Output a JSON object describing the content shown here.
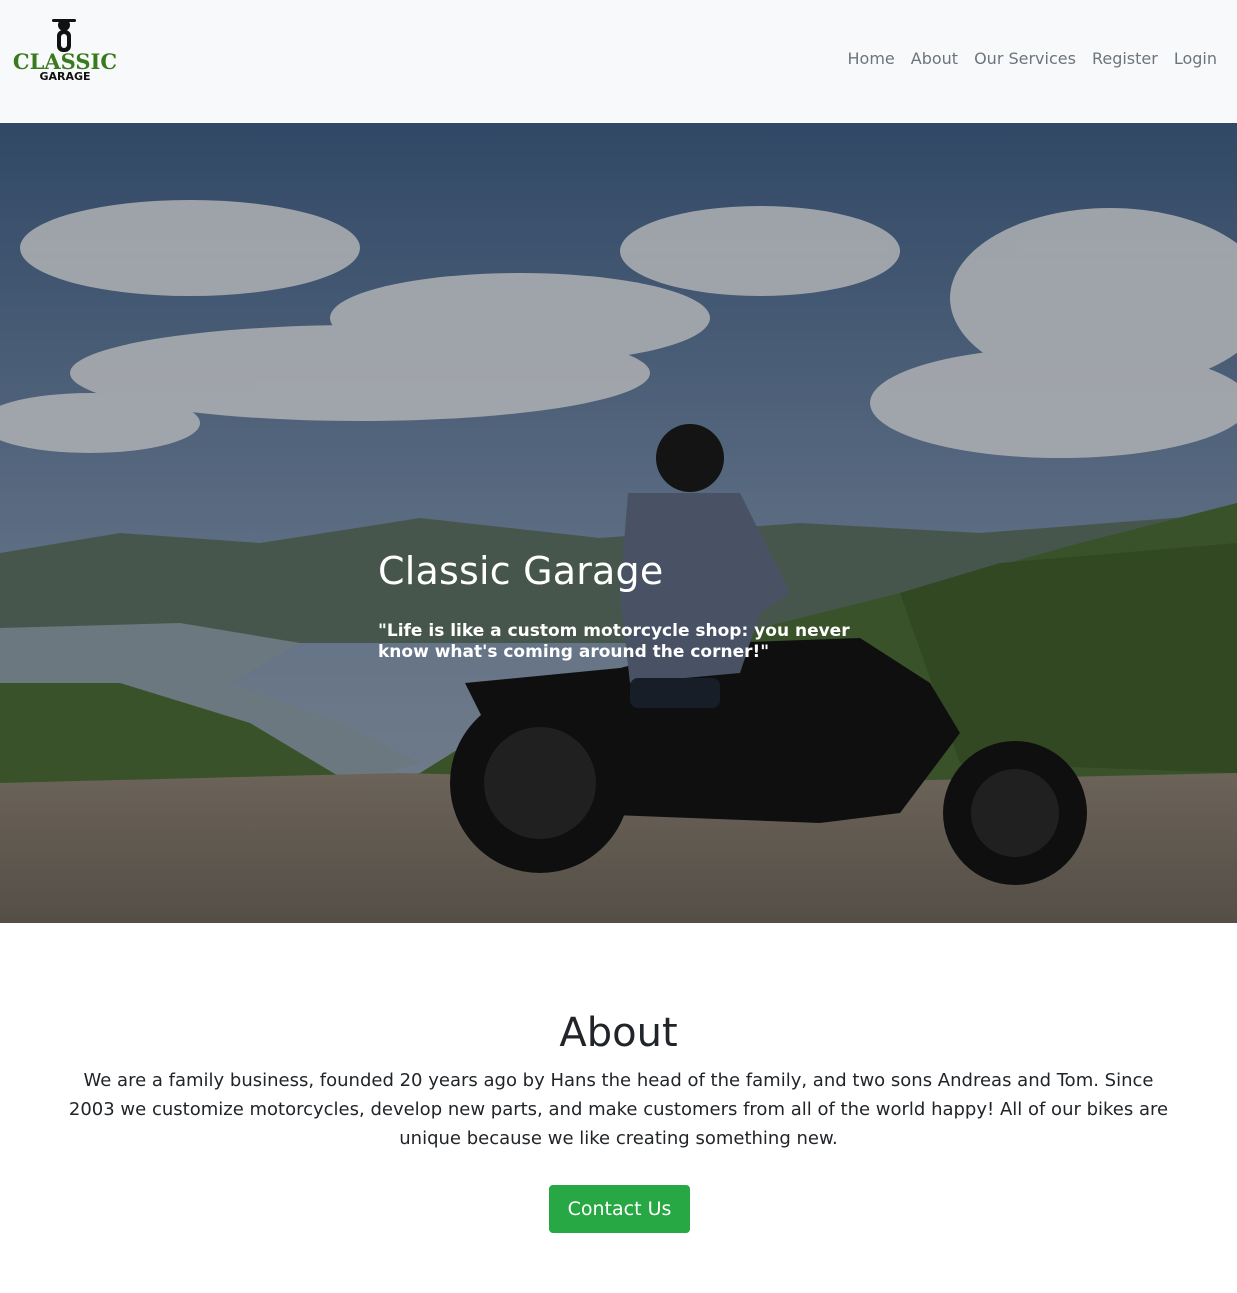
{
  "brand": {
    "line1": "CLASSIC",
    "line2": "GARAGE",
    "accent_color": "#3a7a1f",
    "icon": "motorcycle-rider-icon"
  },
  "nav": {
    "items": [
      "Home",
      "About",
      "Our Services",
      "Register",
      "Login"
    ]
  },
  "hero": {
    "title": "Classic Garage",
    "quote": "\"Life is like a custom motorcycle shop: you never know what's coming around the corner!\""
  },
  "about": {
    "title": "About",
    "text": "We are a family business, founded 20 years ago by Hans the head of the family, and two sons Andreas and Tom. Since 2003 we customize motorcycles, develop new parts, and make customers from all of the world happy! All of our bikes are unique because we like creating something new.",
    "button": "Contact Us",
    "button_color": "#28a745"
  }
}
